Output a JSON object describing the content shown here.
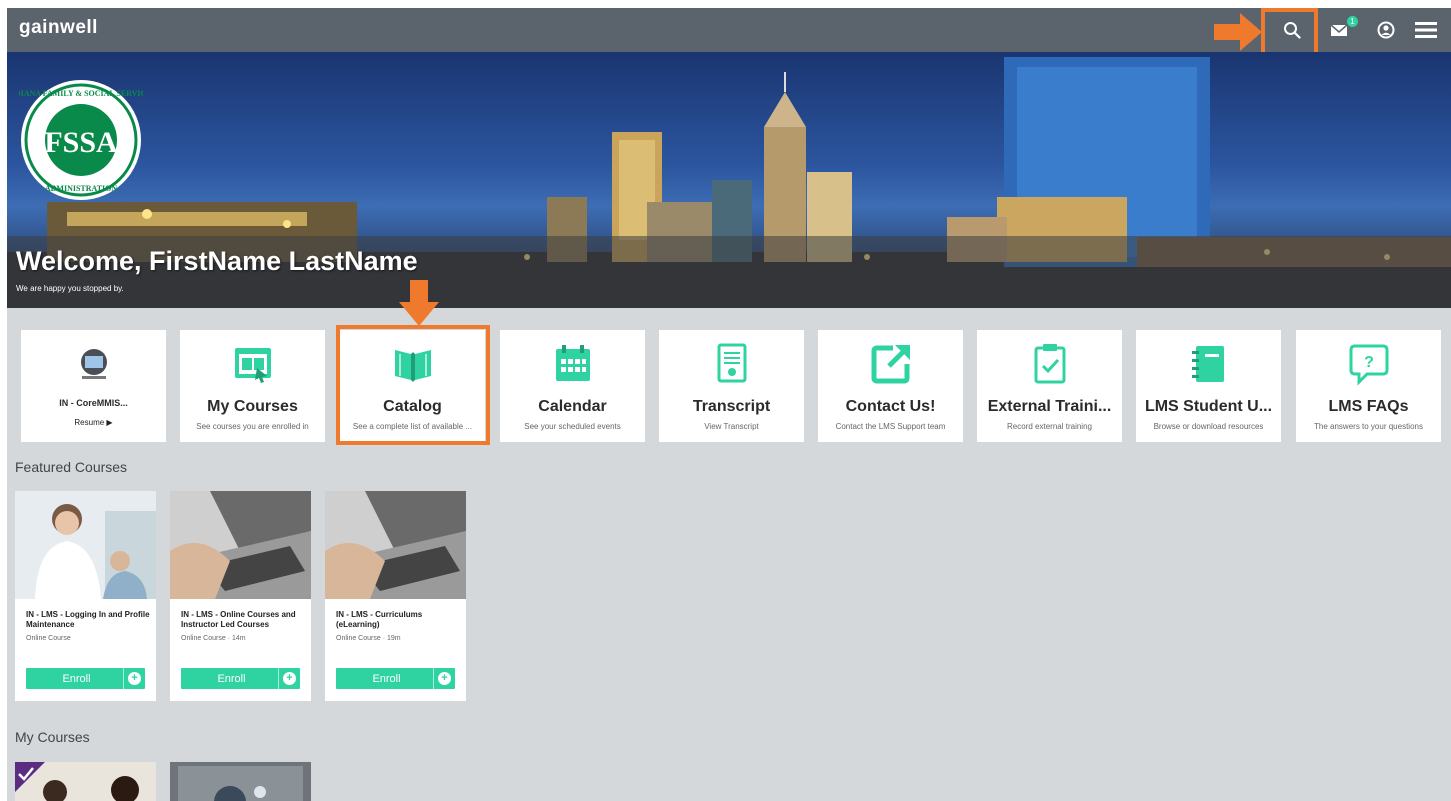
{
  "app": {
    "logo_text": "gainwell"
  },
  "topbar": {
    "search_icon": "search-icon",
    "mail_icon": "mail-icon",
    "mail_badge": "1",
    "user_icon": "user-circle-icon",
    "menu_icon": "hamburger-menu-icon"
  },
  "hero": {
    "welcome": "Welcome, FirstName LastName",
    "subtitle": "We are happy you stopped by.",
    "seal_top": "INDIANA FAMILY & SOCIAL SERVICES",
    "seal_bottom": "ADMINISTRATION",
    "seal_letters": "FSSA"
  },
  "tiles": [
    {
      "title": "IN - CoreMMIS...",
      "subtitle": "Resume ▶",
      "icon": "course-thumbnail-icon"
    },
    {
      "title": "My Courses",
      "subtitle": "See courses you are enrolled in",
      "icon": "my-courses-icon"
    },
    {
      "title": "Catalog",
      "subtitle": "See a complete list of available ...",
      "icon": "book-icon"
    },
    {
      "title": "Calendar",
      "subtitle": "See your scheduled events",
      "icon": "calendar-icon"
    },
    {
      "title": "Transcript",
      "subtitle": "View Transcript",
      "icon": "transcript-icon"
    },
    {
      "title": "Contact Us!",
      "subtitle": "Contact the LMS Support team",
      "icon": "external-link-icon"
    },
    {
      "title": "External Traini...",
      "subtitle": "Record external training",
      "icon": "clipboard-check-icon"
    },
    {
      "title": "LMS Student U...",
      "subtitle": "Browse or download resources",
      "icon": "notebook-icon"
    },
    {
      "title": "LMS FAQs",
      "subtitle": "The answers to your questions",
      "icon": "question-bubble-icon"
    }
  ],
  "featured": {
    "title": "Featured Courses",
    "courses": [
      {
        "name": "IN - LMS - Logging In and Profile Maintenance",
        "meta": "Online Course",
        "enroll": "Enroll"
      },
      {
        "name": "IN - LMS - Online Courses and Instructor Led Courses",
        "meta": "Online Course · 14m",
        "enroll": "Enroll"
      },
      {
        "name": "IN - LMS - Curriculums (eLearning)",
        "meta": "Online Course · 19m",
        "enroll": "Enroll"
      }
    ]
  },
  "my_courses": {
    "title": "My Courses"
  },
  "colors": {
    "accent": "#2fd3a1",
    "highlight": "#ef7a2e",
    "topbar": "#5b636d"
  }
}
